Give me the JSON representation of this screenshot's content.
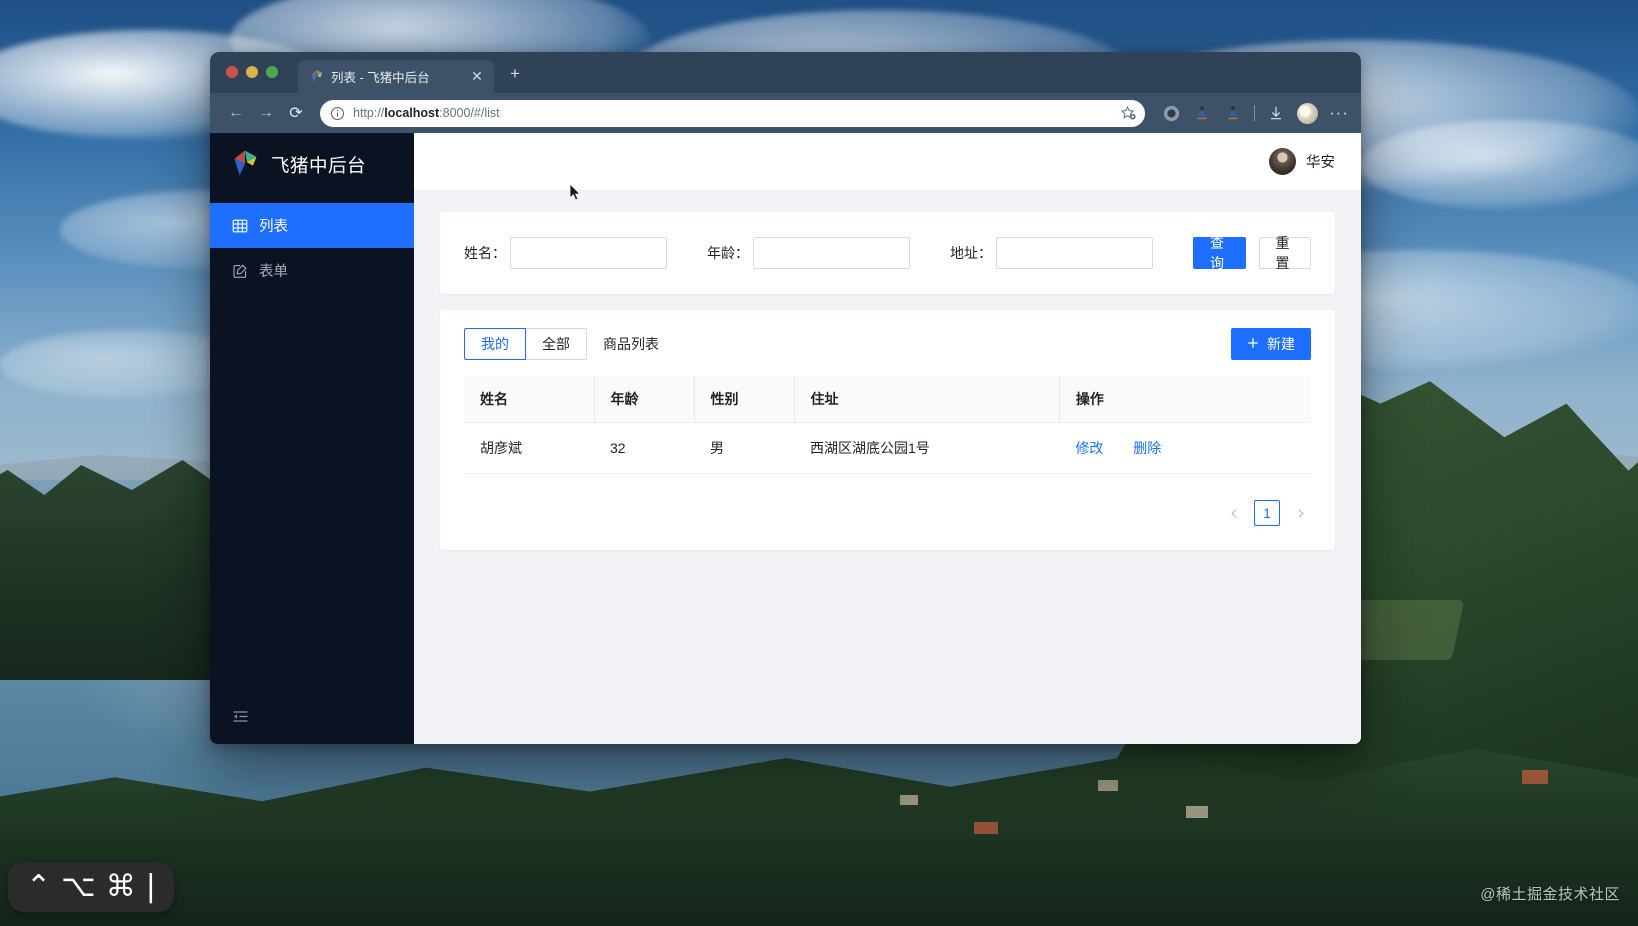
{
  "browser": {
    "tab": {
      "title": "列表 - 飞猪中后台",
      "favicon": "fliggy-favicon",
      "close_label": "✕"
    },
    "new_tab_label": "+",
    "nav": {
      "back": "←",
      "forward": "→",
      "reload": "⟳"
    },
    "omnibox": {
      "info_icon": "info-circle-icon",
      "url_scheme": "http://",
      "url_host": "localhost",
      "url_rest": ":8000/#/list",
      "bookmark_icon": "star-plus-icon"
    },
    "toolbar_icons": [
      "record-circle-icon",
      "extension-person-icon",
      "extension-person-icon",
      "downloads-icon",
      "profile-avatar-icon"
    ],
    "more_label": "···"
  },
  "sidebar": {
    "brand": {
      "logo": "fliggy-logo",
      "name": "飞猪中后台"
    },
    "items": [
      {
        "label": "列表",
        "icon": "table-icon",
        "active": true
      },
      {
        "label": "表单",
        "icon": "edit-square-icon",
        "active": false
      }
    ],
    "collapse_icon": "menu-fold-icon"
  },
  "topbar": {
    "user": {
      "name": "华安",
      "avatar": "user-avatar"
    }
  },
  "filter": {
    "fields": [
      {
        "label": "姓名：",
        "value": "",
        "placeholder": "",
        "name": "name"
      },
      {
        "label": "年龄：",
        "value": "",
        "placeholder": "",
        "name": "age"
      },
      {
        "label": "地址：",
        "value": "",
        "placeholder": "",
        "name": "address"
      }
    ],
    "search_label": "查 询",
    "reset_label": "重 置"
  },
  "list": {
    "tabs": [
      {
        "label": "我的",
        "active": true,
        "style": "segmented"
      },
      {
        "label": "全部",
        "active": false,
        "style": "segmented"
      },
      {
        "label": "商品列表",
        "active": false,
        "style": "plain"
      }
    ],
    "new_button": {
      "icon": "plus-icon",
      "label": "新建"
    },
    "columns": [
      "姓名",
      "年龄",
      "性别",
      "住址",
      "操作"
    ],
    "rows": [
      {
        "name": "胡彦斌",
        "age": "32",
        "gender": "男",
        "address": "西湖区湖底公园1号",
        "actions": [
          "修改",
          "删除"
        ]
      }
    ],
    "pagination": {
      "prev_icon": "chevron-left-icon",
      "next_icon": "chevron-right-icon",
      "pages": [
        "1"
      ],
      "current": "1"
    }
  },
  "overlay": {
    "keycast": [
      "⌃",
      "⌥",
      "⌘",
      "|"
    ],
    "watermark": "@稀土掘金技术社区"
  },
  "colors": {
    "primary": "#1e6eff",
    "sidebar_bg": "#0b1221",
    "page_bg": "#f0f2f5",
    "browser_chrome": "#3d5168"
  }
}
